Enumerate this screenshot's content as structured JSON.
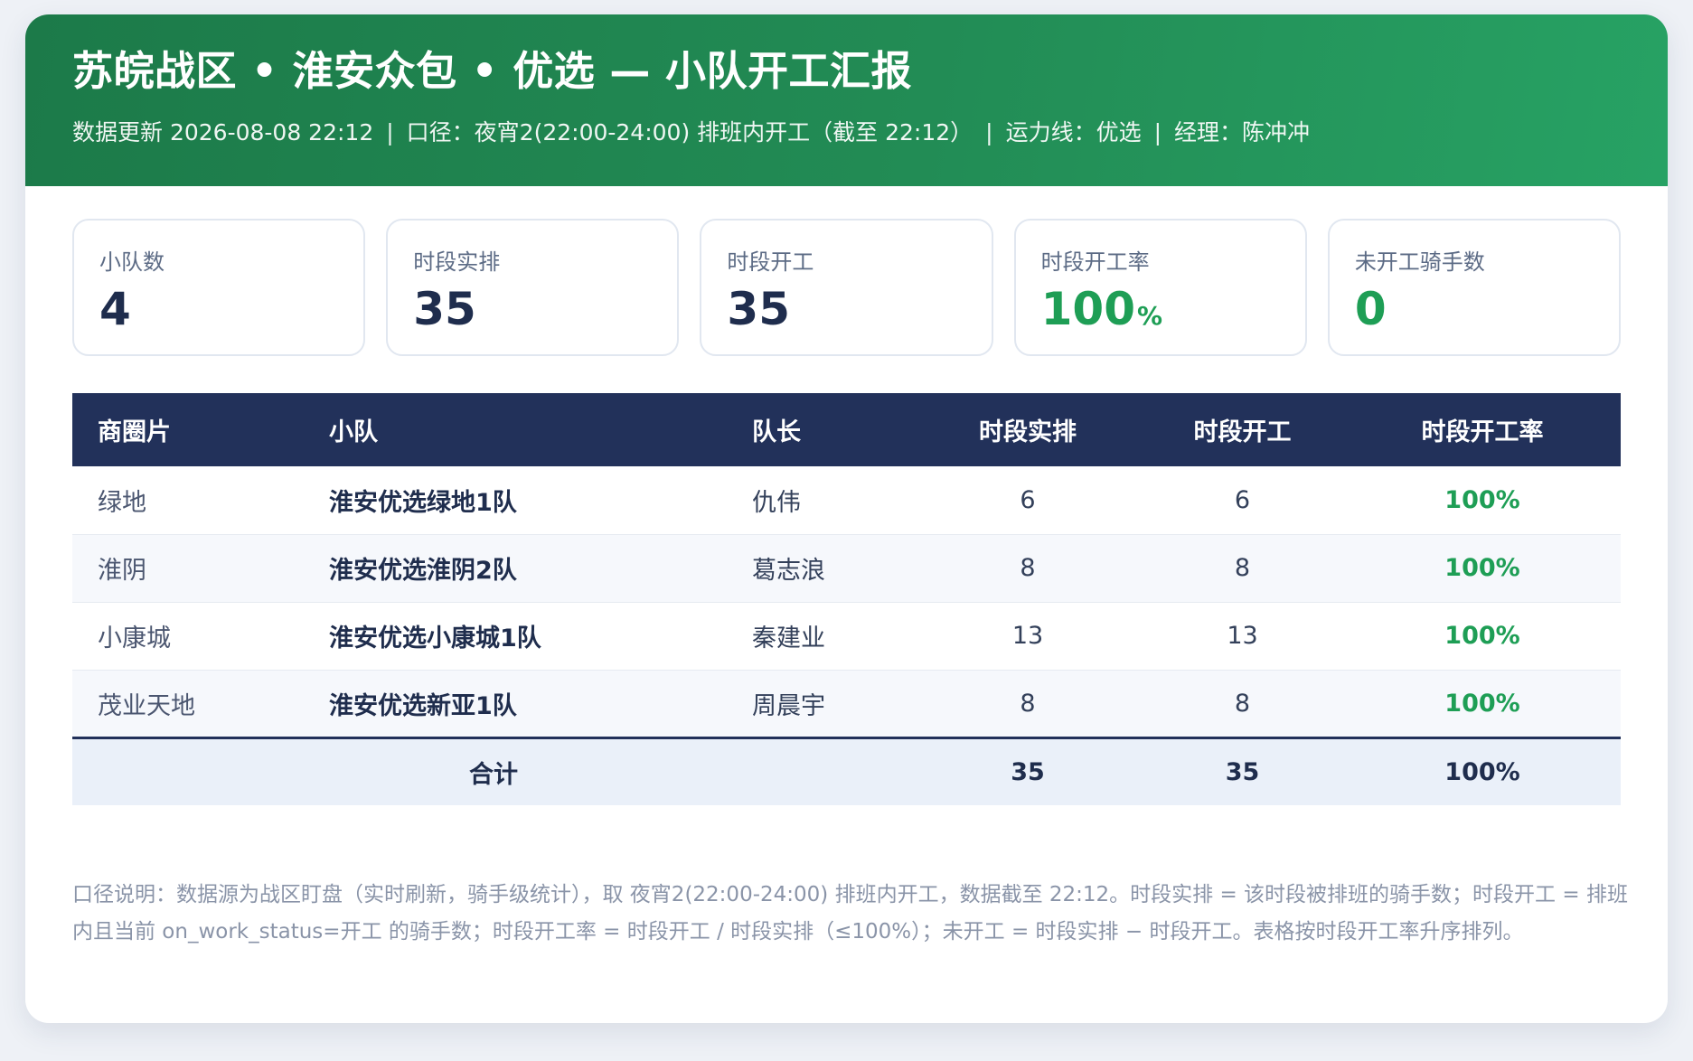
{
  "header": {
    "title": "苏皖战区 • 淮安众包 • 优选 — 小队开工汇报",
    "update": "数据更新 2026-08-08 22:12",
    "sep1": "|",
    "scope": "口径：夜宵2(22:00-24:00) 排班内开工（截至 22:12）",
    "sep2": "|",
    "line": "运力线：优选",
    "sep3": "|",
    "manager": "经理：陈冲冲"
  },
  "kpis": [
    {
      "label": "小队数",
      "value": "4",
      "unit": "",
      "accent": false
    },
    {
      "label": "时段实排",
      "value": "35",
      "unit": "",
      "accent": false
    },
    {
      "label": "时段开工",
      "value": "35",
      "unit": "",
      "accent": false
    },
    {
      "label": "时段开工率",
      "value": "100",
      "unit": "%",
      "accent": true
    },
    {
      "label": "未开工骑手数",
      "value": "0",
      "unit": "",
      "accent": true
    }
  ],
  "table": {
    "headers": [
      "商圈片",
      "小队",
      "队长",
      "时段实排",
      "时段开工",
      "时段开工率"
    ],
    "rows": [
      [
        "绿地",
        "淮安优选绿地1队",
        "仇伟",
        "6",
        "6",
        "100%"
      ],
      [
        "淮阴",
        "淮安优选淮阴2队",
        "葛志浪",
        "8",
        "8",
        "100%"
      ],
      [
        "小康城",
        "淮安优选小康城1队",
        "秦建业",
        "13",
        "13",
        "100%"
      ],
      [
        "茂业天地",
        "淮安优选新亚1队",
        "周晨宇",
        "8",
        "8",
        "100%"
      ]
    ],
    "total": {
      "label": "合计",
      "scheduled": "35",
      "working": "35",
      "rate": "100%"
    }
  },
  "note": "口径说明：数据源为战区盯盘（实时刷新，骑手级统计），取 夜宵2(22:00-24:00) 排班内开工，数据截至 22:12。时段实排 = 该时段被排班的骑手数；时段开工 = 排班内且当前 on_work_status=开工 的骑手数；时段开工率 = 时段开工 / 时段实排（≤100%）；未开工 = 时段实排 − 时段开工。表格按时段开工率升序排列。",
  "colors": {
    "header_green": "#228c55",
    "table_header": "#22315a",
    "accent_green": "#1e9e55"
  }
}
